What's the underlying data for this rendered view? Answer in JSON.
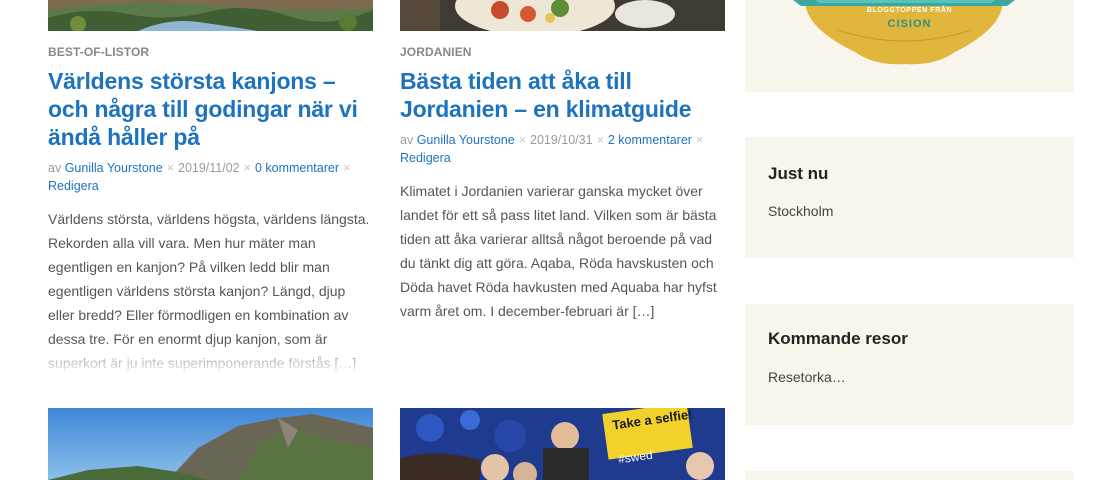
{
  "posts": [
    {
      "category": "BEST-OF-LISTOR",
      "title": "Världens största kanjons – och några till godingar när vi ändå håller på",
      "meta_prefix": "av",
      "author": "Gunilla Yourstone",
      "date": "2019/11/02",
      "comments": "0 kommentarer",
      "edit": "Redigera",
      "excerpt": "Världens största, världens högsta, världens längsta. Rekorden alla vill vara. Men hur mäter man egentligen en kanjon? På vilken ledd blir man egentligen världens största kanjon? Längd, djup eller bredd? Eller förmodligen en kombination av dessa tre. För en enormt djup kanjon, som är superkort är ju inte superimponerande förstås […]"
    },
    {
      "category": "JORDANIEN",
      "title": "Bästa tiden att åka till Jordanien – en klimatguide",
      "meta_prefix": "av",
      "author": "Gunilla Yourstone",
      "date": "2019/10/31",
      "comments": "2 kommentarer",
      "edit": "Redigera",
      "excerpt": "Klimatet i Jordanien varierar ganska mycket över landet för ett så pass litet land. Vilken som är bästa tiden att åka varierar alltså något beroende på vad du tänkt dig att göra. Aqaba, Röda havskusten och Döda havet Röda havkusten med Aquaba har hyfst varm året om. I december-februari är […]"
    }
  ],
  "badge": {
    "line1": "BLOGGTOPPEN FRÅN",
    "line2": "CISION"
  },
  "selfie_sign": {
    "line1": "Take a selfie!",
    "hashtag": "#swed"
  },
  "sidebar": [
    {
      "title": "Just nu",
      "text": "Stockholm"
    },
    {
      "title": "Kommande resor",
      "text": "Resetorka…"
    }
  ]
}
